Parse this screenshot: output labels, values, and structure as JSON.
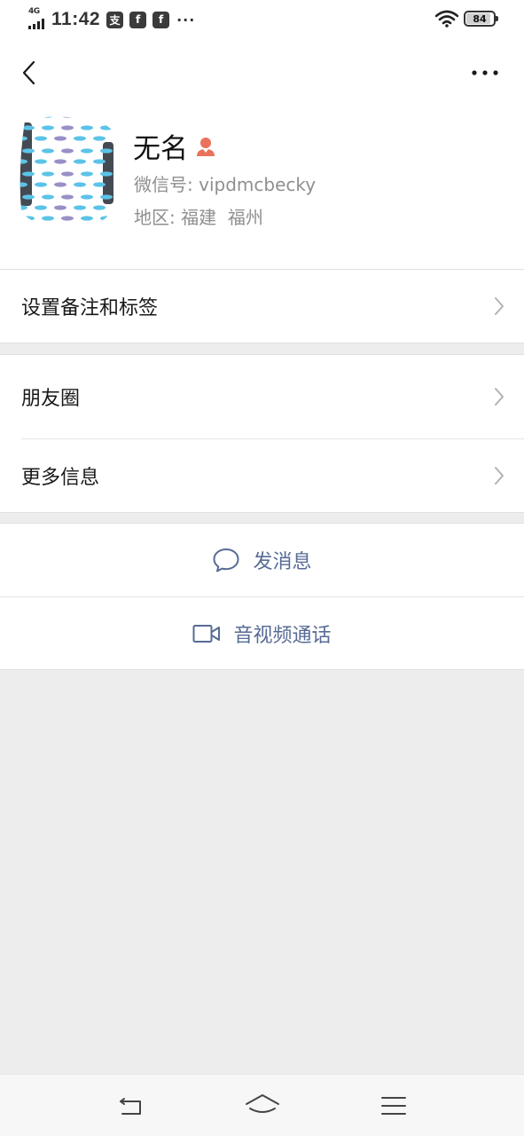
{
  "status_bar": {
    "network": "4G",
    "time": "11:42",
    "app_icons": [
      "支",
      "f",
      "f"
    ],
    "more": "···",
    "battery": "84"
  },
  "header": {
    "back_icon": "chevron-left-icon",
    "more_icon": "more-dots-icon"
  },
  "profile": {
    "name": "无名",
    "gender_icon": "female-person-icon",
    "gender_color": "#e8735a",
    "wechat_id_label": "微信号: ",
    "wechat_id": "vipdmcbecky",
    "region_label": "地区: ",
    "region": "福建  福州"
  },
  "menu": {
    "remark_tags": "设置备注和标签",
    "moments": "朋友圈",
    "more_info": "更多信息"
  },
  "actions": {
    "send_message": "发消息",
    "av_call": "音视频通话",
    "accent": "#576b95"
  },
  "system_nav": {
    "back": "back-icon",
    "home": "home-icon",
    "menu": "menu-icon"
  }
}
